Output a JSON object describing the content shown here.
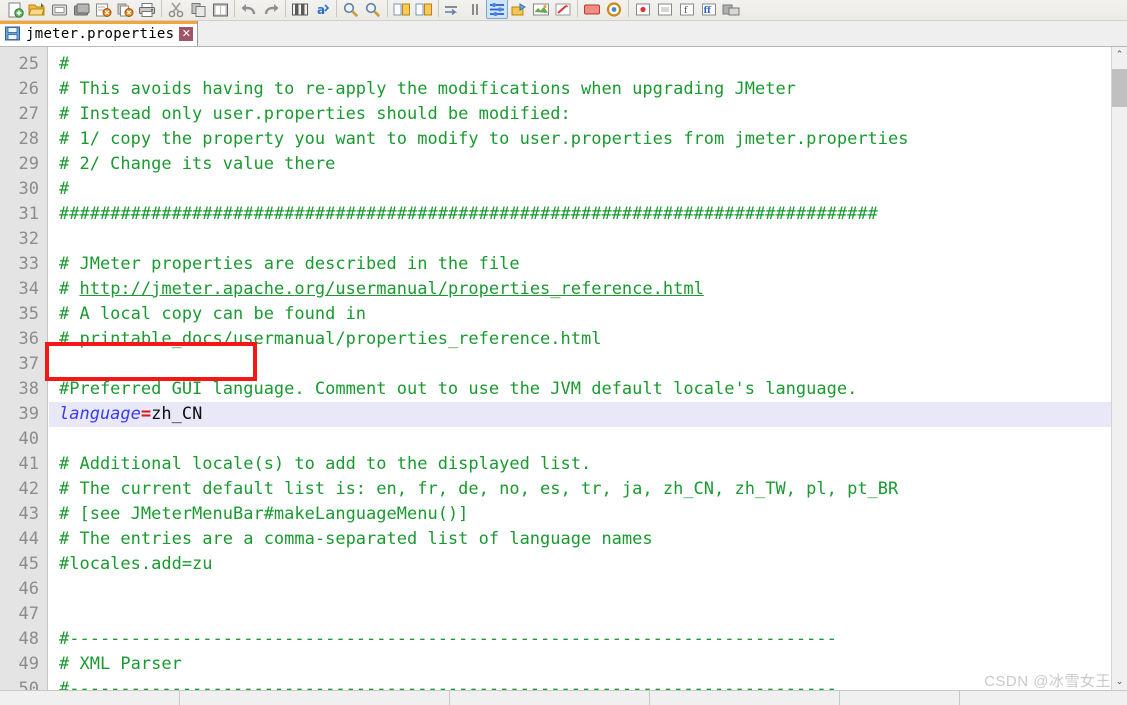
{
  "window": {
    "title": "jmeter.properties"
  },
  "toolbar": {
    "items": [
      {
        "name": "new-file-icon",
        "label": "New"
      },
      {
        "name": "open-file-icon",
        "label": "Open"
      },
      {
        "name": "save-icon",
        "label": "Save"
      },
      {
        "name": "save-all-icon",
        "label": "Save All"
      },
      {
        "name": "close-file-icon",
        "label": "Close"
      },
      {
        "name": "close-all-icon",
        "label": "Close All"
      },
      {
        "name": "print-icon",
        "label": "Print"
      },
      {
        "name": "separator-1",
        "label": "|"
      },
      {
        "name": "cut-icon",
        "label": "Cut"
      },
      {
        "name": "copy-icon",
        "label": "Copy"
      },
      {
        "name": "paste-icon",
        "label": "Paste"
      },
      {
        "name": "separator-2",
        "label": "|"
      },
      {
        "name": "undo-icon",
        "label": "Undo"
      },
      {
        "name": "redo-icon",
        "label": "Redo"
      },
      {
        "name": "separator-3",
        "label": "|"
      },
      {
        "name": "find-icon",
        "label": "Find"
      },
      {
        "name": "replace-icon",
        "label": "Replace"
      },
      {
        "name": "separator-4",
        "label": "|"
      },
      {
        "name": "zoom-in-icon",
        "label": "Zoom In"
      },
      {
        "name": "zoom-out-icon",
        "label": "Zoom Out"
      },
      {
        "name": "separator-5",
        "label": "|"
      },
      {
        "name": "sync-scroll-v-icon",
        "label": "Synchronize Vertical Scrolling"
      },
      {
        "name": "sync-scroll-h-icon",
        "label": "Synchronize Horizontal Scrolling"
      },
      {
        "name": "separator-6",
        "label": "|"
      },
      {
        "name": "word-wrap-icon",
        "label": "Word Wrap"
      },
      {
        "name": "show-all-chars-icon",
        "label": "Show All Characters"
      },
      {
        "name": "indent-guide-icon",
        "label": "Show Indent Guide"
      },
      {
        "name": "user-defined-dialog-icon",
        "label": "User Defined Dialog"
      },
      {
        "name": "show-symbol-icon",
        "label": "Show Symbol"
      },
      {
        "name": "document-map-icon",
        "label": "Document Map"
      },
      {
        "name": "function-list-icon",
        "label": "Function List"
      },
      {
        "name": "separator-7",
        "label": "|"
      },
      {
        "name": "record-macro-icon",
        "label": "Start Recording"
      },
      {
        "name": "stop-macro-icon",
        "label": "Stop Recording"
      },
      {
        "name": "playback-macro-icon",
        "label": "Playback"
      },
      {
        "name": "run-macro-multiple-icon",
        "label": "Run a Macro Multiple Times"
      },
      {
        "name": "save-macro-icon",
        "label": "Save Current Recorded Macro"
      }
    ]
  },
  "tab": {
    "label": "jmeter.properties",
    "close_glyph": "✕",
    "icon_name": "saved-document-icon"
  },
  "editor": {
    "first_line": 25,
    "lines": [
      {
        "n": 25,
        "segments": [
          {
            "t": "comment",
            "s": "#"
          }
        ]
      },
      {
        "n": 26,
        "segments": [
          {
            "t": "comment",
            "s": "# This avoids having to re-apply the modifications when upgrading JMeter"
          }
        ]
      },
      {
        "n": 27,
        "segments": [
          {
            "t": "comment",
            "s": "# Instead only user.properties should be modified:"
          }
        ]
      },
      {
        "n": 28,
        "segments": [
          {
            "t": "comment",
            "s": "# 1/ copy the property you want to modify to user.properties from jmeter.properties"
          }
        ]
      },
      {
        "n": 29,
        "segments": [
          {
            "t": "comment",
            "s": "# 2/ Change its value there"
          }
        ]
      },
      {
        "n": 30,
        "segments": [
          {
            "t": "comment",
            "s": "#"
          }
        ]
      },
      {
        "n": 31,
        "segments": [
          {
            "t": "comment",
            "s": "################################################################################"
          }
        ]
      },
      {
        "n": 32,
        "segments": []
      },
      {
        "n": 33,
        "segments": [
          {
            "t": "comment",
            "s": "# JMeter properties are described in the file"
          }
        ]
      },
      {
        "n": 34,
        "segments": [
          {
            "t": "comment",
            "s": "# "
          },
          {
            "t": "link",
            "s": "http://jmeter.apache.org/usermanual/properties_reference.html"
          }
        ]
      },
      {
        "n": 35,
        "segments": [
          {
            "t": "comment",
            "s": "# A local copy can be found in"
          }
        ]
      },
      {
        "n": 36,
        "segments": [
          {
            "t": "comment",
            "s": "# printable_docs/usermanual/properties_reference.html"
          }
        ]
      },
      {
        "n": 37,
        "segments": []
      },
      {
        "n": 38,
        "segments": [
          {
            "t": "comment",
            "s": "#Preferred GUI language. Comment out to use the JVM default locale's language."
          }
        ]
      },
      {
        "n": 39,
        "current": true,
        "segments": [
          {
            "t": "key",
            "s": "language"
          },
          {
            "t": "eq",
            "s": "="
          },
          {
            "t": "val",
            "s": "zh_CN"
          }
        ]
      },
      {
        "n": 40,
        "segments": []
      },
      {
        "n": 41,
        "segments": [
          {
            "t": "comment",
            "s": "# Additional locale(s) to add to the displayed list."
          }
        ]
      },
      {
        "n": 42,
        "segments": [
          {
            "t": "comment",
            "s": "# The current default list is: en, fr, de, no, es, tr, ja, zh_CN, zh_TW, pl, pt_BR"
          }
        ]
      },
      {
        "n": 43,
        "segments": [
          {
            "t": "comment",
            "s": "# [see JMeterMenuBar#makeLanguageMenu()]"
          }
        ]
      },
      {
        "n": 44,
        "segments": [
          {
            "t": "comment",
            "s": "# The entries are a comma-separated list of language names"
          }
        ]
      },
      {
        "n": 45,
        "segments": [
          {
            "t": "comment",
            "s": "#locales.add=zu"
          }
        ]
      },
      {
        "n": 46,
        "segments": []
      },
      {
        "n": 47,
        "segments": []
      },
      {
        "n": 48,
        "segments": [
          {
            "t": "comment",
            "s": "#---------------------------------------------------------------------------"
          }
        ]
      },
      {
        "n": 49,
        "segments": [
          {
            "t": "comment",
            "s": "# XML Parser"
          }
        ]
      },
      {
        "n": 50,
        "segments": [
          {
            "t": "comment",
            "s": "#---------------------------------------------------------------------------"
          }
        ]
      }
    ]
  },
  "annotation": {
    "type": "red-rectangle-highlight",
    "target_line": 39,
    "color": "#f51616"
  },
  "scrollbar": {
    "up_arrow": "⌃",
    "down_arrow": "⌄"
  },
  "statusbar": {
    "cells": [
      "",
      "",
      "",
      "",
      "",
      ""
    ]
  },
  "watermark": {
    "text": "CSDN @冰雪女王"
  },
  "colors": {
    "comment_green": "#1a9a30",
    "key_blue": "#3a3af0",
    "operator_red": "#e01010",
    "current_line_bg": "#e8e8f8",
    "gutter_bg": "#e4e4e4",
    "tab_accent": "#f0a63c",
    "annotation_red": "#f51616"
  }
}
